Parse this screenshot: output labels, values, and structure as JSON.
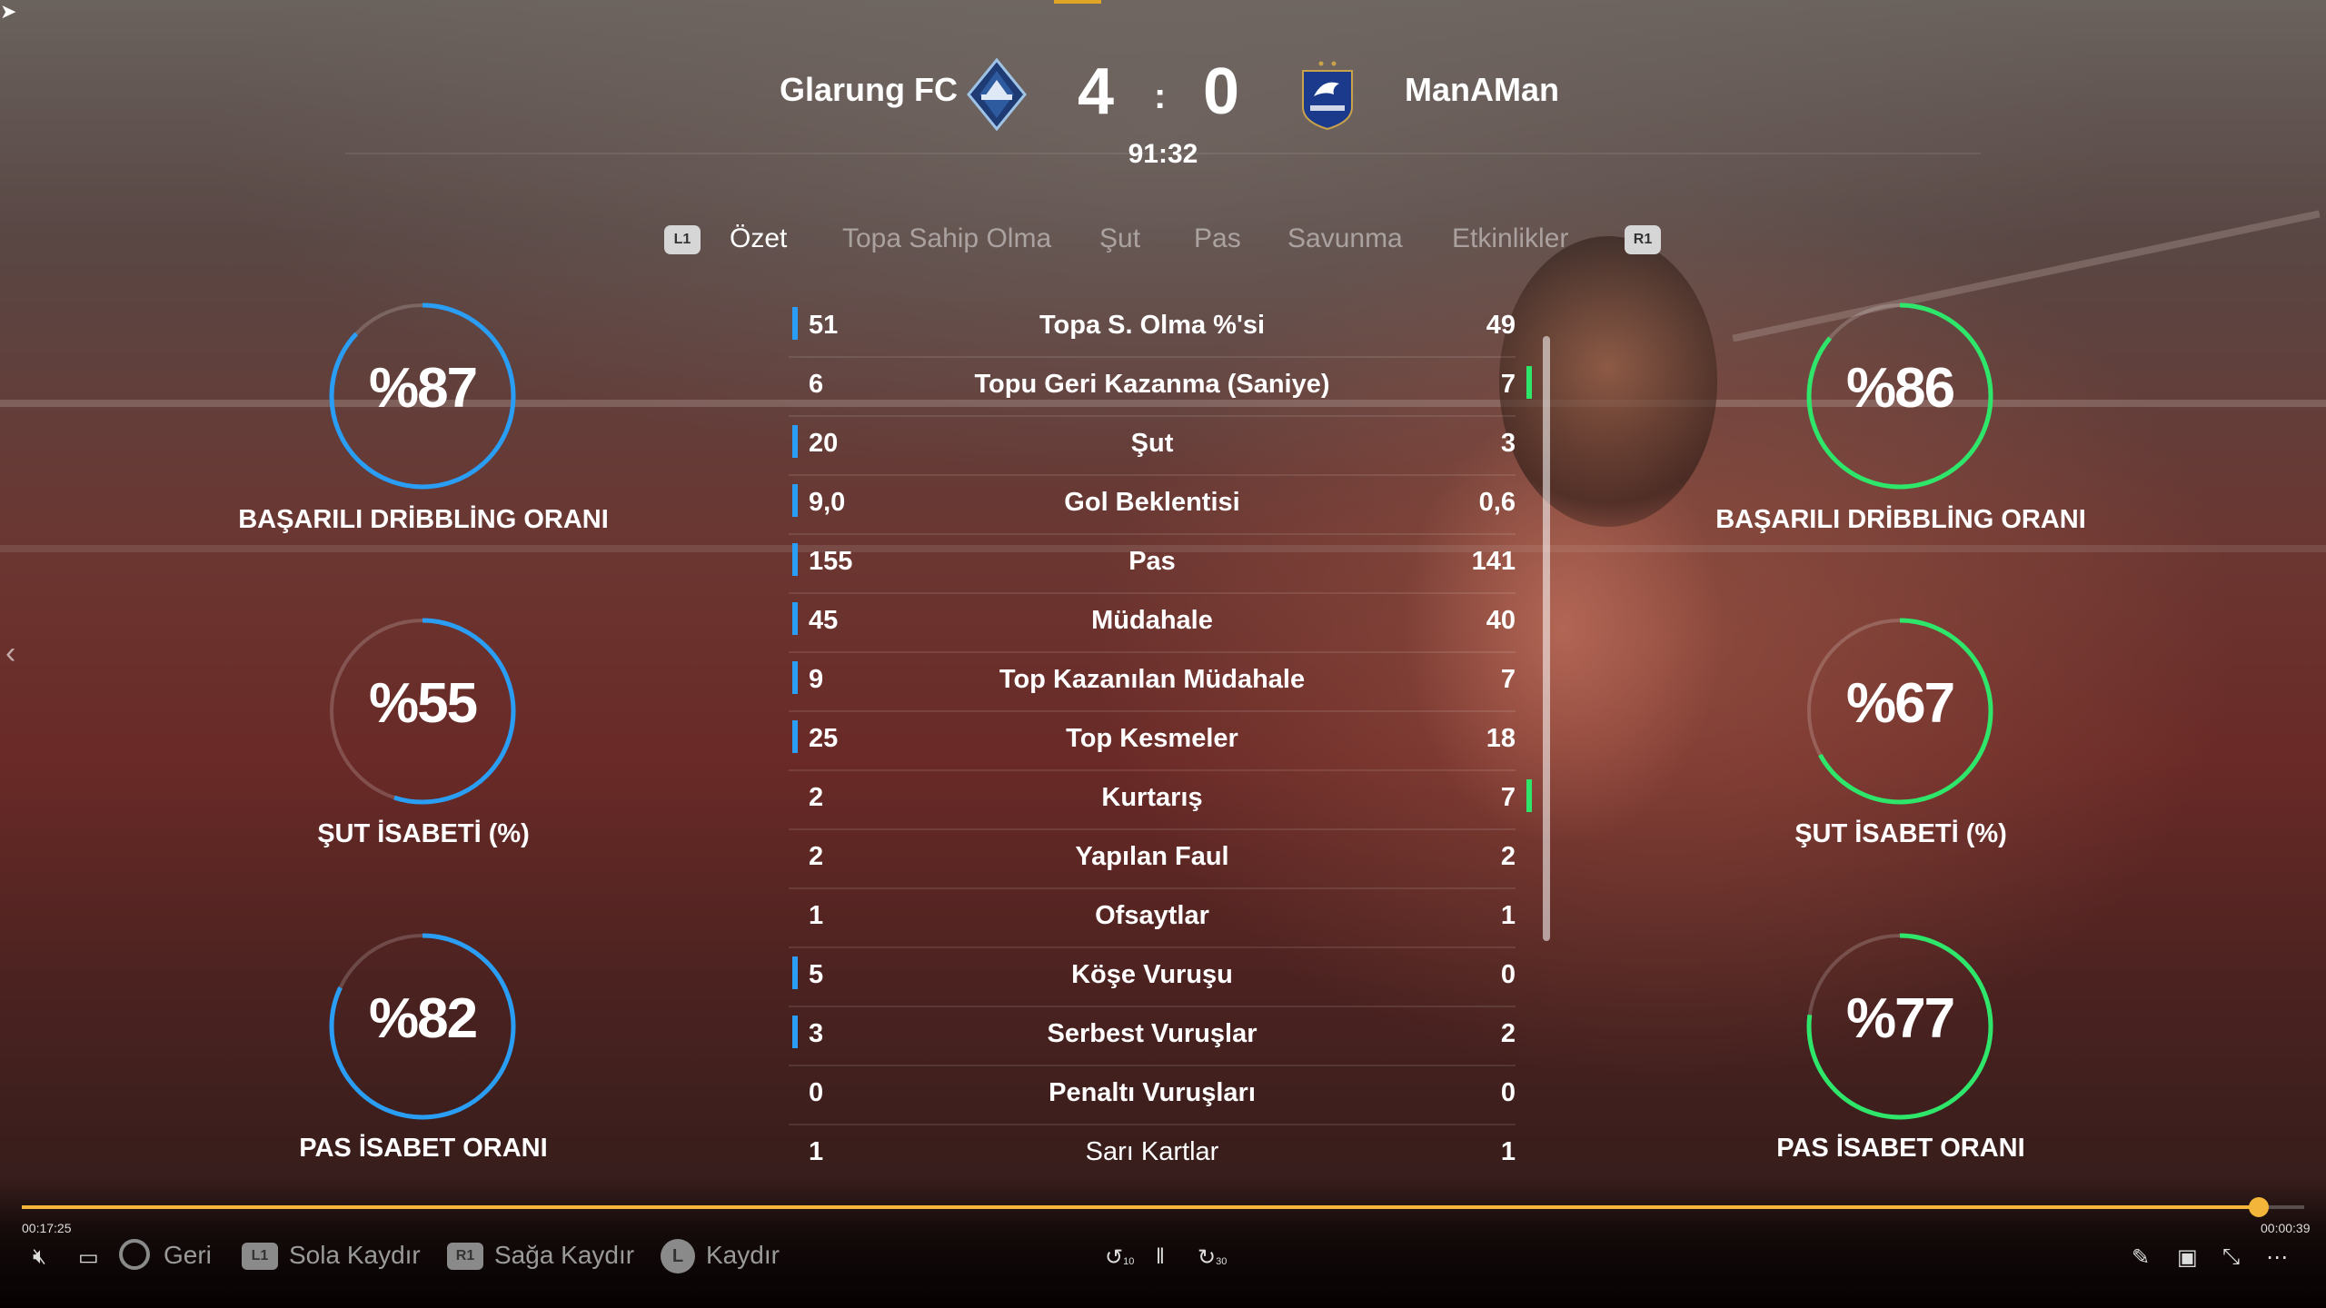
{
  "colors": {
    "home": "#2a9df4",
    "away": "#2ee66a",
    "accent": "#f3b53a"
  },
  "match": {
    "home_team": "Glarung FC",
    "away_team": "ManAMan",
    "home_score": "4",
    "away_score": "0",
    "separator": ":",
    "clock": "91:32",
    "home_crest_icon": "whitecaps-crest-icon",
    "away_crest_icon": "france-crest-icon"
  },
  "tabs": {
    "prev_button": "L1",
    "next_button": "R1",
    "items": [
      "Özet",
      "Topa Sahip Olma",
      "Şut",
      "Pas",
      "Savunma",
      "Etkinlikler"
    ],
    "active_index": 0
  },
  "left_circles": [
    {
      "value": "%87",
      "percent": 87,
      "label": "BAŞARILI DRİBBLİNG ORANI"
    },
    {
      "value": "%55",
      "percent": 55,
      "label": "ŞUT İSABETİ (%)"
    },
    {
      "value": "%82",
      "percent": 82,
      "label": "PAS İSABET ORANI"
    }
  ],
  "right_circles": [
    {
      "value": "%86",
      "percent": 86,
      "label": "BAŞARILI DRİBBLİNG ORANI"
    },
    {
      "value": "%67",
      "percent": 67,
      "label": "ŞUT İSABETİ (%)"
    },
    {
      "value": "%77",
      "percent": 77,
      "label": "PAS İSABET ORANI"
    }
  ],
  "stats": [
    {
      "name": "Topa S. Olma %'si",
      "home": "51",
      "away": "49",
      "leader": "home"
    },
    {
      "name": "Topu Geri Kazanma (Saniye)",
      "home": "6",
      "away": "7",
      "leader": "away"
    },
    {
      "name": "Şut",
      "home": "20",
      "away": "3",
      "leader": "home"
    },
    {
      "name": "Gol Beklentisi",
      "home": "9,0",
      "away": "0,6",
      "leader": "home"
    },
    {
      "name": "Pas",
      "home": "155",
      "away": "141",
      "leader": "home"
    },
    {
      "name": "Müdahale",
      "home": "45",
      "away": "40",
      "leader": "home"
    },
    {
      "name": "Top Kazanılan Müdahale",
      "home": "9",
      "away": "7",
      "leader": "home"
    },
    {
      "name": "Top Kesmeler",
      "home": "25",
      "away": "18",
      "leader": "home"
    },
    {
      "name": "Kurtarış",
      "home": "2",
      "away": "7",
      "leader": "away"
    },
    {
      "name": "Yapılan Faul",
      "home": "2",
      "away": "2",
      "leader": "none"
    },
    {
      "name": "Ofsaytlar",
      "home": "1",
      "away": "1",
      "leader": "none"
    },
    {
      "name": "Köşe Vuruşu",
      "home": "5",
      "away": "0",
      "leader": "home"
    },
    {
      "name": "Serbest Vuruşlar",
      "home": "3",
      "away": "2",
      "leader": "home"
    },
    {
      "name": "Penaltı Vuruşları",
      "home": "0",
      "away": "0",
      "leader": "none"
    },
    {
      "name": "Sarı Kartlar",
      "home": "1",
      "away": "1",
      "leader": "none"
    }
  ],
  "player": {
    "elapsed": "00:17:25",
    "remaining": "00:00:39",
    "progress": 0.98,
    "rewind_label": "10",
    "forward_label": "30"
  },
  "controls": {
    "back_label": "Geri",
    "left_badge": "L1",
    "left_label": "Sola Kaydır",
    "right_badge": "R1",
    "right_label": "Sağa Kaydır",
    "stick_badge": "L",
    "stick_label": "Kaydır"
  }
}
